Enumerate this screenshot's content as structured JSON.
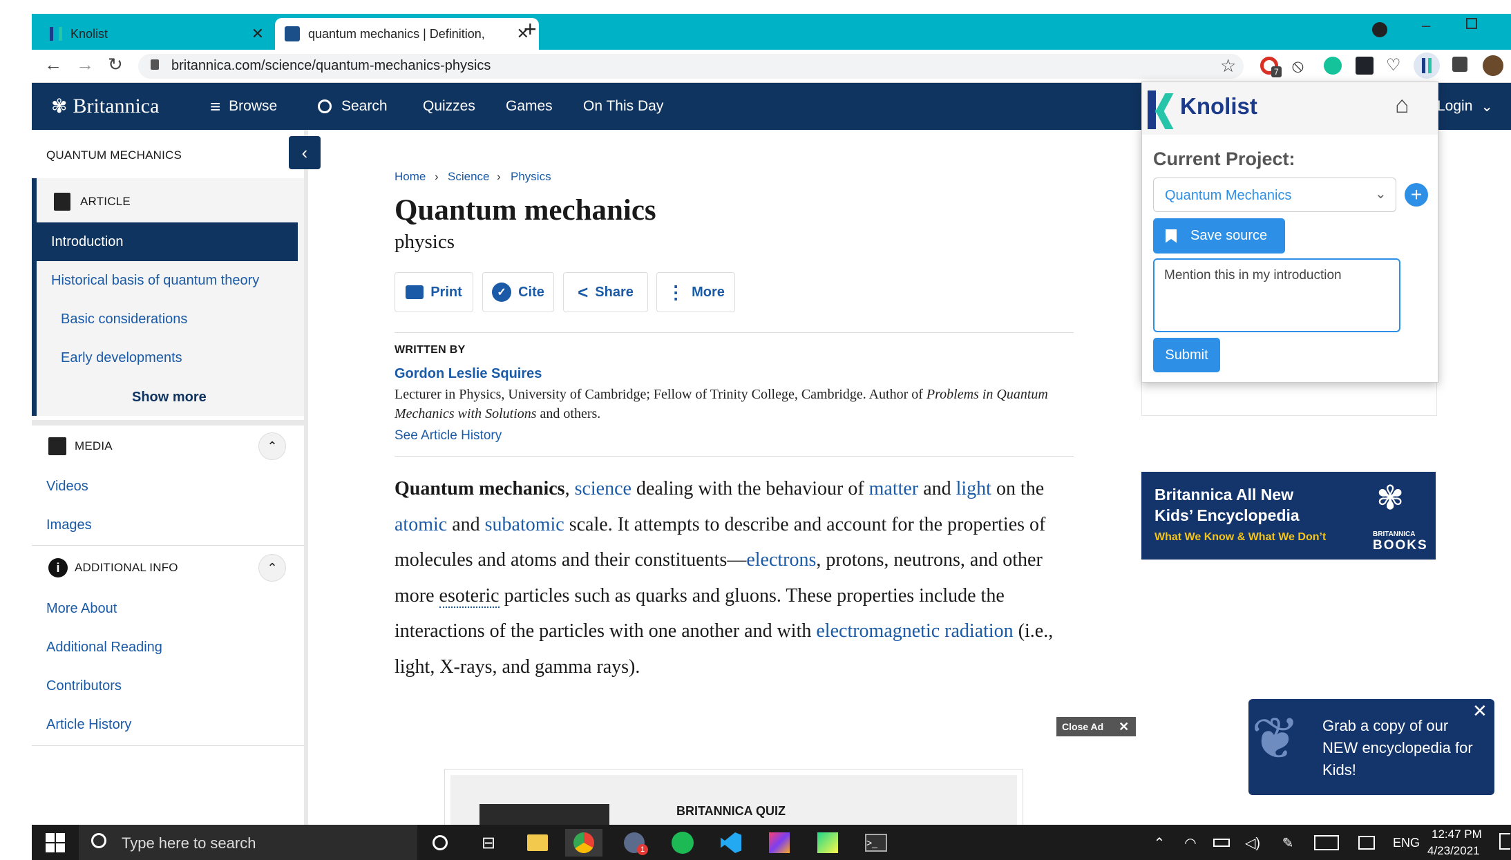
{
  "browser": {
    "tabs": [
      {
        "label": "Knolist"
      },
      {
        "label": "quantum mechanics | Definition,"
      }
    ],
    "url": "britannica.com/science/quantum-mechanics-physics",
    "extension_badge": "7"
  },
  "site_nav": {
    "logo": "Britannica",
    "items": [
      "Browse",
      "Search",
      "Quizzes",
      "Games",
      "On This Day"
    ],
    "login": "Login"
  },
  "sidebar": {
    "topic": "QUANTUM MECHANICS",
    "article_header": "ARTICLE",
    "article_items": [
      "Introduction",
      "Historical basis of quantum theory",
      "Basic considerations",
      "Early developments"
    ],
    "show_more": "Show more",
    "media_header": "MEDIA",
    "media_items": [
      "Videos",
      "Images"
    ],
    "info_header": "ADDITIONAL INFO",
    "info_items": [
      "More About",
      "Additional Reading",
      "Contributors",
      "Article History"
    ]
  },
  "article": {
    "breadcrumb": [
      "Home",
      "Science",
      "Physics"
    ],
    "title": "Quantum mechanics",
    "subtitle": "physics",
    "actions": [
      "Print",
      "Cite",
      "Share",
      "More"
    ],
    "written_by_label": "WRITTEN BY",
    "author": "Gordon Leslie Squires",
    "author_bio_1": "Lecturer in Physics, University of Cambridge; Fellow of Trinity College, Cambridge. Author of ",
    "author_bio_book": "Problems in Quantum Mechanics with Solutions",
    "author_bio_2": " and others.",
    "history_link": "See Article History",
    "para": {
      "t0": "Quantum mechanics",
      "t1": ", ",
      "l1": "science",
      "t2": " dealing with the behaviour of ",
      "l2": "matter",
      "t3": " and ",
      "l3": "light",
      "t4": " on the ",
      "l4": "atomic",
      "t5": " and ",
      "l5": "subatomic",
      "t6": " scale. It attempts to describe and account for the properties of molecules and atoms and their constituents—",
      "l6": "electrons",
      "t7": ", protons, neutrons, and other more ",
      "u1": "esoteric",
      "t8": " particles such as quarks and gluons. These properties include the interactions of the particles with one another and with ",
      "l7": "electromagnetic radiation",
      "t9": " (i.e., light, X-rays, and gamma rays)."
    },
    "quiz_label": "BRITANNICA QUIZ",
    "close_ad": "Close Ad"
  },
  "ads": {
    "kids_title_1": "Britannica All New",
    "kids_title_2": "Kids’ Encyclopedia",
    "kids_tagline": "What We Know & What We Don’t",
    "books_1": "BRITANNICA",
    "books_2": "BOOKS",
    "promo_text": "Grab a copy of our NEW encyclopedia for Kids!"
  },
  "knolist": {
    "brand": "Knolist",
    "current_project_label": "Current Project:",
    "project": "Quantum Mechanics",
    "save_source": "Save source",
    "note": "Mention this in my introduction",
    "submit": "Submit"
  },
  "taskbar": {
    "search_placeholder": "Type here to search",
    "lang": "ENG",
    "time": "12:47 PM",
    "date": "4/23/2021",
    "chrome_badge": "1"
  },
  "colors": {
    "chrome_teal": "#00b2c6",
    "britannica_navy": "#0f3460",
    "link_blue": "#1a5aa6",
    "knolist_blue": "#2d8fe6"
  }
}
